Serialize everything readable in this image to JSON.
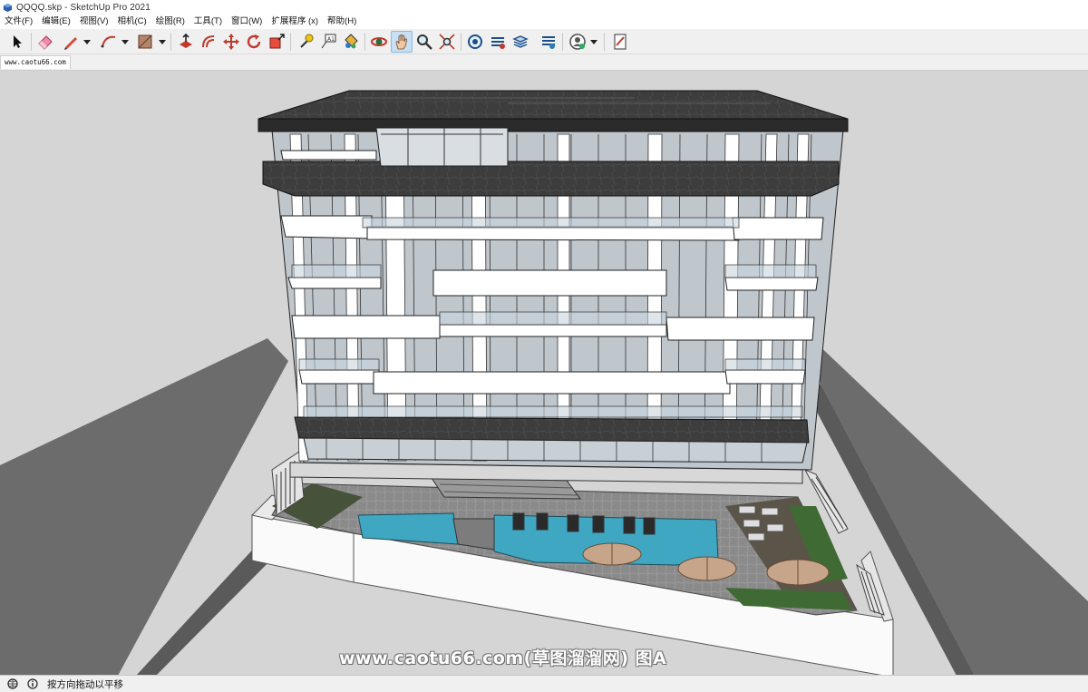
{
  "window": {
    "title": "QQQQ.skp - SketchUp Pro 2021"
  },
  "menu": {
    "items": [
      "文件(F)",
      "编辑(E)",
      "视图(V)",
      "相机(C)",
      "绘图(R)",
      "工具(T)",
      "窗口(W)",
      "扩展程序 (x)",
      "帮助(H)"
    ]
  },
  "toolbar": {
    "tools": [
      {
        "name": "select-icon"
      },
      {
        "name": "eraser-icon"
      },
      {
        "name": "pencil-line-icon"
      },
      {
        "name": "arc-icon"
      },
      {
        "name": "rectangle-shape-icon"
      },
      {
        "name": "push-pull-icon"
      },
      {
        "name": "offset-icon"
      },
      {
        "name": "move-icon"
      },
      {
        "name": "rotate-icon"
      },
      {
        "name": "scale-icon"
      },
      {
        "name": "tape-measure-icon"
      },
      {
        "name": "text-icon"
      },
      {
        "name": "paint-bucket-icon"
      },
      {
        "name": "orbit-icon"
      },
      {
        "name": "pan-hand-icon",
        "active": true
      },
      {
        "name": "zoom-icon"
      },
      {
        "name": "zoom-extents-icon"
      },
      {
        "name": "warehouse-icon"
      },
      {
        "name": "extension-warehouse-icon"
      },
      {
        "name": "layout-icon"
      },
      {
        "name": "extension-manager-icon"
      },
      {
        "name": "profile-icon"
      },
      {
        "name": "report-icon"
      }
    ]
  },
  "scene_tabs": [
    "www.caotu66.com"
  ],
  "viewport": {
    "watermark": "www.caotu66.com(草图溜溜网) 图A"
  },
  "statusbar": {
    "hint": "按方向拖动以平移"
  },
  "colors": {
    "viewport_bg": "#d5d5d5",
    "roof": "#3a3a3a",
    "glass": "#bfc6cc",
    "pool": "#3fa7c2",
    "accent_active": "#c9dff3"
  }
}
